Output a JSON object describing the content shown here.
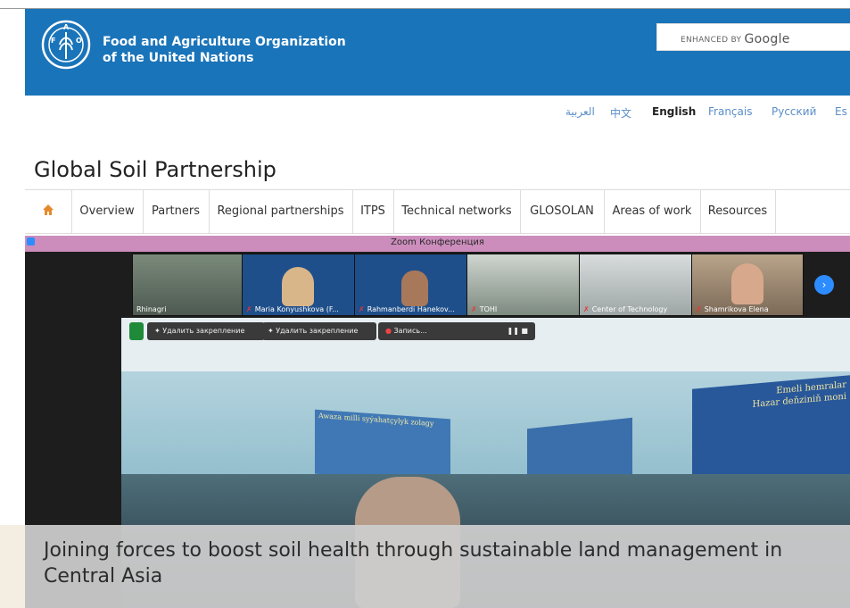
{
  "header": {
    "org_line1": "Food and Agriculture Organization",
    "org_line2": "of the United Nations",
    "search_prefix": "ENHANCED BY",
    "search_brand": "Google",
    "color": "#1a74b9"
  },
  "languages": [
    {
      "label": "العربية"
    },
    {
      "label": "中文"
    },
    {
      "label": "English"
    },
    {
      "label": "Français"
    },
    {
      "label": "Русский"
    },
    {
      "label": "Es"
    }
  ],
  "site_title": "Global Soil Partnership",
  "nav": {
    "home_icon": "home-icon",
    "items": [
      {
        "label": "Overview"
      },
      {
        "label": "Partners"
      },
      {
        "label": "Regional partnerships"
      },
      {
        "label": "ITPS"
      },
      {
        "label": "Technical networks"
      },
      {
        "label": "GLOSOLAN"
      },
      {
        "label": "Areas of work"
      },
      {
        "label": "Resources"
      }
    ]
  },
  "zoom": {
    "title": "Zoom Конференция",
    "participants": [
      {
        "name": "Rhinagri"
      },
      {
        "name": "Maria Konyushkova (F..."
      },
      {
        "name": "Rahmanberdi Hanekov..."
      },
      {
        "name": "TOHI"
      },
      {
        "name": "Center of Technology"
      },
      {
        "name": "Shamrikova Elena"
      }
    ],
    "controls": {
      "unpin1": "Удалить закрепление",
      "unpin2": "Удалить закрепление",
      "record": "Запись..."
    },
    "poster_left": "Awaza milli syýahatçylyk zolagy",
    "poster_right_line1": "Emeli hemralar",
    "poster_right_line2": "Hazar deňziniň moni"
  },
  "caption": "Joining forces to boost soil health through sustainable land management in Central Asia"
}
